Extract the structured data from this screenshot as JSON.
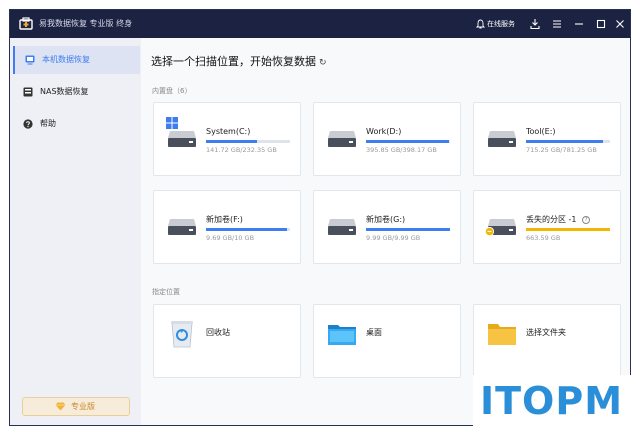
{
  "titlebar": {
    "app_title": "易我数据恢复 专业版 终身",
    "online_service": "在线服务"
  },
  "sidebar": {
    "items": [
      {
        "label": "本机数据恢复",
        "active": true,
        "icon": "pc-icon"
      },
      {
        "label": "NAS数据恢复",
        "active": false,
        "icon": "nas-icon"
      },
      {
        "label": "帮助",
        "active": false,
        "icon": "help-icon"
      }
    ],
    "pro_button": "专业版"
  },
  "main": {
    "heading": "选择一个扫描位置，开始恢复数据",
    "internal_disks_label": "内置盘（6）",
    "drives": [
      {
        "name": "System(C:)",
        "size": "141.72 GB/232.35 GB",
        "used_fraction": 0.61,
        "windows": true,
        "bar_color": "#3f7ef0"
      },
      {
        "name": "Work(D:)",
        "size": "395.85 GB/398.17 GB",
        "used_fraction": 0.99,
        "windows": false,
        "bar_color": "#3f7ef0"
      },
      {
        "name": "Tool(E:)",
        "size": "715.25 GB/781.25 GB",
        "used_fraction": 0.92,
        "windows": false,
        "bar_color": "#3f7ef0"
      },
      {
        "name": "新加卷(F:)",
        "size": "9.69 GB/10 GB",
        "used_fraction": 0.97,
        "windows": false,
        "bar_color": "#3f7ef0"
      },
      {
        "name": "新加卷(G:)",
        "size": "9.99 GB/9.99 GB",
        "used_fraction": 1.0,
        "windows": false,
        "bar_color": "#3f7ef0"
      },
      {
        "name": "丢失的分区 -1",
        "size": "663.59 GB",
        "used_fraction": 1.0,
        "windows": false,
        "bar_color": "#f2b700",
        "lost": true
      }
    ],
    "locations_label": "指定位置",
    "locations": [
      {
        "name": "回收站",
        "icon": "recycle-bin-icon"
      },
      {
        "name": "桌面",
        "icon": "desktop-icon"
      },
      {
        "name": "选择文件夹",
        "icon": "folder-icon"
      }
    ]
  },
  "watermark": "ITOPM"
}
